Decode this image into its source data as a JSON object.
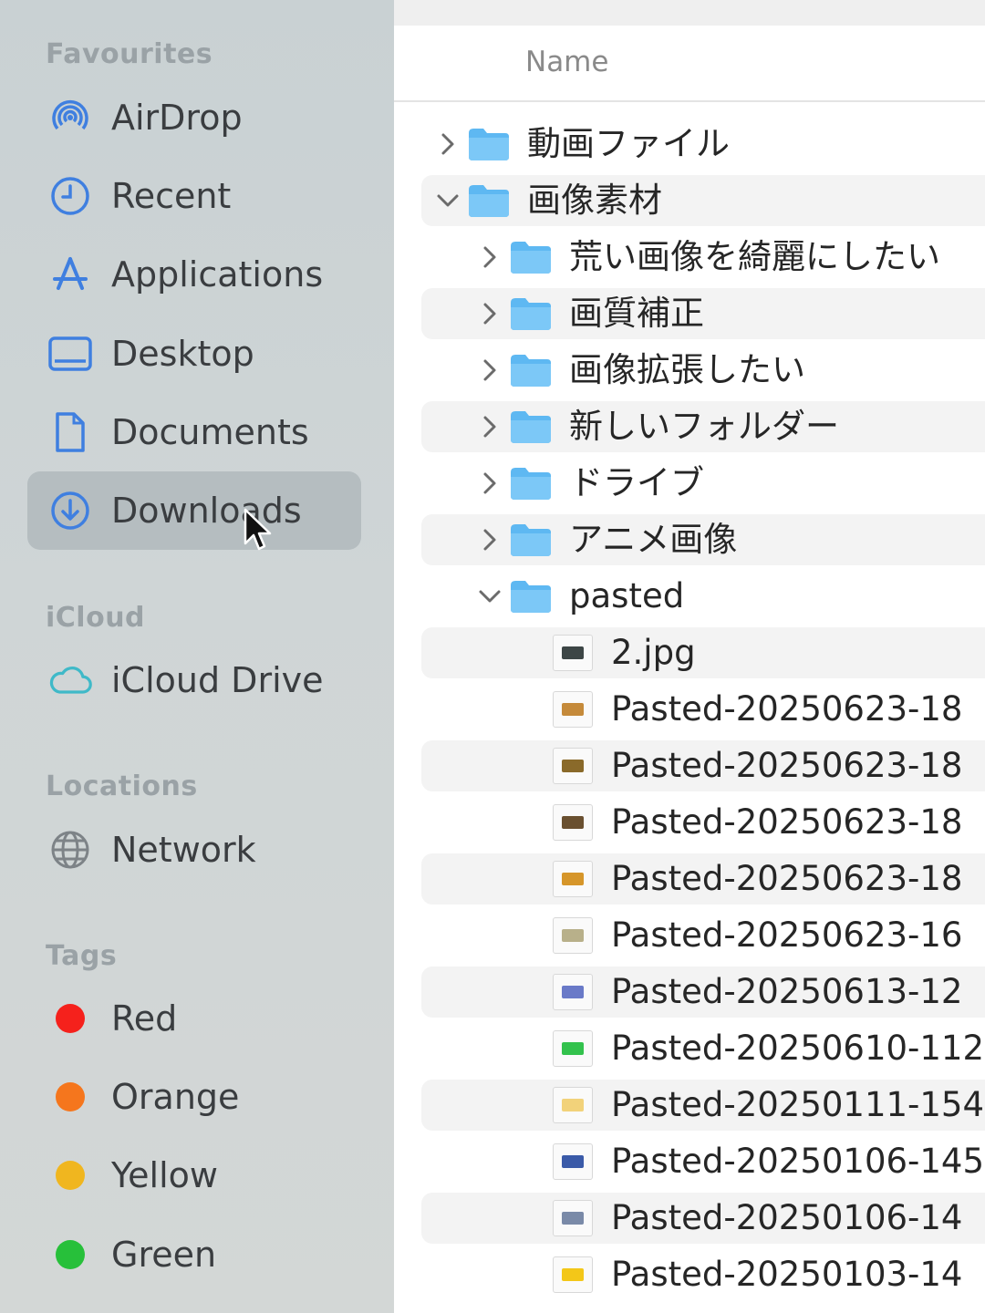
{
  "sidebar": {
    "favourites_header": "Favourites",
    "favourites": [
      {
        "label": "AirDrop",
        "icon": "airdrop-icon"
      },
      {
        "label": "Recent",
        "icon": "clock-icon"
      },
      {
        "label": "Applications",
        "icon": "applications-icon"
      },
      {
        "label": "Desktop",
        "icon": "desktop-icon"
      },
      {
        "label": "Documents",
        "icon": "document-icon"
      },
      {
        "label": "Downloads",
        "icon": "download-icon",
        "selected": true
      }
    ],
    "icloud_header": "iCloud",
    "icloud": [
      {
        "label": "iCloud Drive",
        "icon": "cloud-icon"
      }
    ],
    "locations_header": "Locations",
    "locations": [
      {
        "label": "Network",
        "icon": "globe-icon"
      }
    ],
    "tags_header": "Tags",
    "tags": [
      {
        "label": "Red",
        "color": "#f5211c"
      },
      {
        "label": "Orange",
        "color": "#f5761d"
      },
      {
        "label": "Yellow",
        "color": "#f0b61f"
      },
      {
        "label": "Green",
        "color": "#27c03a"
      }
    ]
  },
  "main": {
    "column_name": "Name",
    "rows": [
      {
        "label": "動画ファイル",
        "kind": "folder",
        "expanded": false
      },
      {
        "label": "画像素材",
        "kind": "folder",
        "expanded": true
      },
      {
        "label": "荒い画像を綺麗にしたい",
        "kind": "folder",
        "expanded": false
      },
      {
        "label": "画質補正",
        "kind": "folder",
        "expanded": false
      },
      {
        "label": "画像拡張したい",
        "kind": "folder",
        "expanded": false
      },
      {
        "label": "新しいフォルダー",
        "kind": "folder",
        "expanded": false
      },
      {
        "label": "ドライブ",
        "kind": "folder",
        "expanded": false
      },
      {
        "label": "アニメ画像",
        "kind": "folder",
        "expanded": false
      },
      {
        "label": "pasted",
        "kind": "folder",
        "expanded": true
      },
      {
        "label": "2.jpg",
        "kind": "image",
        "thumb_color": "#3d4646"
      },
      {
        "label": "Pasted-20250623-18",
        "kind": "image",
        "thumb_color": "#c58a3a"
      },
      {
        "label": "Pasted-20250623-18",
        "kind": "image",
        "thumb_color": "#8a6a2a"
      },
      {
        "label": "Pasted-20250623-18",
        "kind": "image",
        "thumb_color": "#6a5030"
      },
      {
        "label": "Pasted-20250623-18",
        "kind": "image",
        "thumb_color": "#d6962a"
      },
      {
        "label": "Pasted-20250623-16",
        "kind": "image",
        "thumb_color": "#b8b08a"
      },
      {
        "label": "Pasted-20250613-12",
        "kind": "image",
        "thumb_color": "#6a7ac8"
      },
      {
        "label": "Pasted-20250610-112",
        "kind": "image",
        "thumb_color": "#33c24d"
      },
      {
        "label": "Pasted-20250111-154",
        "kind": "image",
        "thumb_color": "#f2d27a"
      },
      {
        "label": "Pasted-20250106-145",
        "kind": "image",
        "thumb_color": "#3a5aa8"
      },
      {
        "label": "Pasted-20250106-14",
        "kind": "image",
        "thumb_color": "#7a8aa8"
      },
      {
        "label": "Pasted-20250103-14",
        "kind": "image",
        "thumb_color": "#f3c718"
      }
    ]
  }
}
